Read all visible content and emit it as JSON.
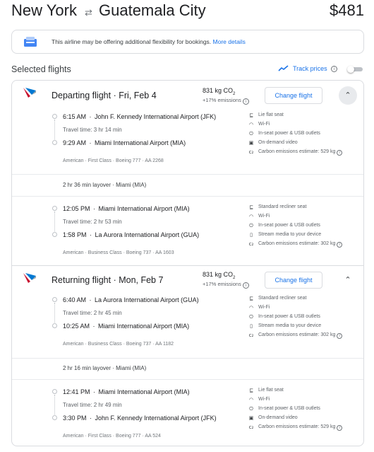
{
  "header": {
    "origin": "New York",
    "swap_icon": "swap-arrows-icon",
    "destination": "Guatemala City",
    "price": "$481"
  },
  "notice": {
    "icon": "airline-ticket-icon",
    "text": "This airline may be offering additional flexibility for bookings.",
    "link": "More details"
  },
  "selected": {
    "title": "Selected flights",
    "track_label": "Track prices",
    "track_enabled": false
  },
  "departing": {
    "title": "Departing flight",
    "date": "Fri, Feb 4",
    "co2": "831 kg CO",
    "co2_sub": "2",
    "emissions": "+17% emissions",
    "change_label": "Change flight",
    "segments": [
      {
        "dep_time": "6:15 AM",
        "dep_airport": "John F. Kennedy International Airport (JFK)",
        "travel_time": "Travel time: 3 hr 14 min",
        "arr_time": "9:29 AM",
        "arr_airport": "Miami International Airport (MIA)",
        "meta": "American · First Class · Boeing 777 · AA 2268",
        "amenities": [
          "Lie flat seat",
          "Wi-Fi",
          "In-seat power & USB outlets",
          "On-demand video",
          "Carbon emissions estimate: 529 kg"
        ]
      },
      {
        "dep_time": "12:05 PM",
        "dep_airport": "Miami International Airport (MIA)",
        "travel_time": "Travel time: 2 hr 53 min",
        "arr_time": "1:58 PM",
        "arr_airport": "La Aurora International Airport (GUA)",
        "meta": "American · Business Class · Boeing 737 · AA 1603",
        "amenities": [
          "Standard recliner seat",
          "Wi-Fi",
          "In-seat power & USB outlets",
          "Stream media to your device",
          "Carbon emissions estimate: 302 kg"
        ]
      }
    ],
    "layover": "2 hr 36 min layover · Miami (MIA)"
  },
  "returning": {
    "title": "Returning flight",
    "date": "Mon, Feb 7",
    "co2": "831 kg CO",
    "co2_sub": "2",
    "emissions": "+17% emissions",
    "change_label": "Change flight",
    "segments": [
      {
        "dep_time": "6:40 AM",
        "dep_airport": "La Aurora International Airport (GUA)",
        "travel_time": "Travel time: 2 hr 45 min",
        "arr_time": "10:25 AM",
        "arr_airport": "Miami International Airport (MIA)",
        "meta": "American · Business Class · Boeing 737 · AA 1182",
        "amenities": [
          "Standard recliner seat",
          "Wi-Fi",
          "In-seat power & USB outlets",
          "Stream media to your device",
          "Carbon emissions estimate: 302 kg"
        ]
      },
      {
        "dep_time": "12:41 PM",
        "dep_airport": "Miami International Airport (MIA)",
        "travel_time": "Travel time: 2 hr 49 min",
        "arr_time": "3:30 PM",
        "arr_airport": "John F. Kennedy International Airport (JFK)",
        "meta": "American · First Class · Boeing 777 · AA 524",
        "amenities": [
          "Lie flat seat",
          "Wi-Fi",
          "In-seat power & USB outlets",
          "On-demand video",
          "Carbon emissions estimate: 529 kg"
        ]
      }
    ],
    "layover": "2 hr 16 min layover · Miami (MIA)"
  },
  "colors": {
    "accent": "#1a73e8",
    "border": "#dadce0",
    "muted_text": "#5f6368"
  }
}
